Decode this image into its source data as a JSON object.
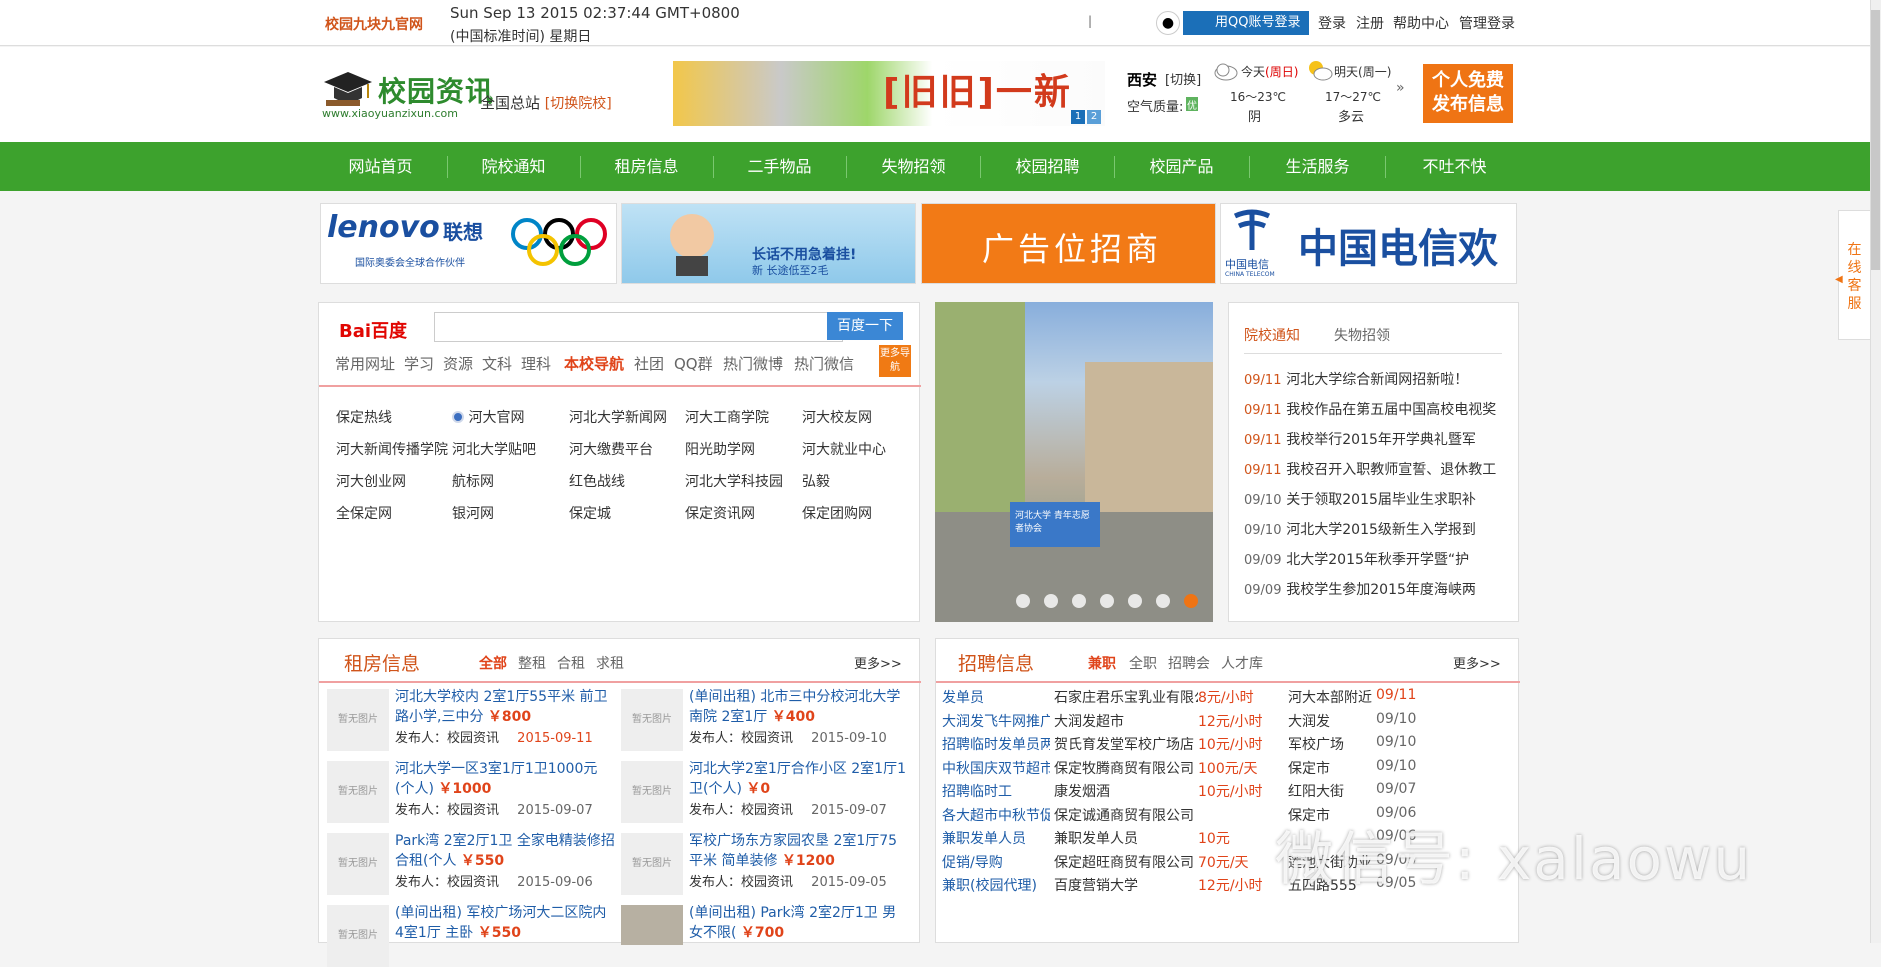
{
  "topbar": {
    "site_name": "校园九块九官网",
    "datetime_line1": "Sun Sep 13 2015 02:37:44 GMT+0800",
    "datetime_line2": "(中国标准时间) 星期日",
    "qq_login": "用QQ账号登录",
    "links": [
      "登录",
      "注册",
      "帮助中心",
      "管理登录"
    ]
  },
  "header": {
    "logo_text": "校园资讯",
    "logo_url": "www.xiaoyuanzixun.com",
    "branch": "全国总站",
    "branch_switch": "[切换院校]",
    "ad_text": "[旧旧]一新",
    "ad_pages": [
      "1",
      "2"
    ],
    "city": "西安",
    "city_switch": "[切换]",
    "air_quality_label": "空气质量:",
    "air_quality_value": "优",
    "weather": [
      {
        "label": "今天",
        "day": "(周日)",
        "temp": "16～23℃",
        "desc": "阴"
      },
      {
        "label": "明天",
        "day": "(周一)",
        "temp": "17～27℃",
        "desc": "多云"
      }
    ],
    "publish_button": [
      "个人免费",
      "发布信息"
    ]
  },
  "nav": [
    "网站首页",
    "院校通知",
    "租房信息",
    "二手物品",
    "失物招领",
    "校园招聘",
    "校园产品",
    "生活服务",
    "不吐不快"
  ],
  "ads": [
    {
      "brand": "lenovo",
      "brand_cn": "联想",
      "sub": "国际奥委会全球合作伙伴"
    },
    {
      "text": "长话不用急着挂!",
      "sub": "新 长途低至2毛"
    },
    {
      "text": "广告位招商"
    },
    {
      "brand": "中国电信",
      "brand_en": "CHINA TELECOM",
      "text": "中国电信欢迎您"
    }
  ],
  "search": {
    "logo": "Bai百度",
    "placeholder": "",
    "button": "百度一下",
    "tabs": [
      "常用网址",
      "学习",
      "资源",
      "文科",
      "理科",
      "本校导航",
      "社团",
      "QQ群",
      "热门微博",
      "热门微信"
    ],
    "active_tab": "本校导航",
    "more": "更多导航",
    "links": [
      [
        "保定热线",
        "河大官网",
        "河北大学新闻网",
        "河大工商学院",
        "河大校友网"
      ],
      [
        "河大新闻传播学院",
        "河北大学贴吧",
        "河大缴费平台",
        "阳光助学网",
        "河大就业中心"
      ],
      [
        "河大创业网",
        "航标网",
        "红色战线",
        "河北大学科技园",
        "弘毅"
      ],
      [
        "全保定网",
        "银河网",
        "保定城",
        "保定资讯网",
        "保定团购网"
      ]
    ]
  },
  "slider": {
    "dots": 7,
    "active": 7,
    "banner_text": "河北大学 青年志愿者协会"
  },
  "notices": {
    "tabs": [
      "院校通知",
      "失物招领"
    ],
    "items": [
      {
        "date": "09/11",
        "title": "河北大学综合新闻网招新啦！"
      },
      {
        "date": "09/11",
        "title": "我校作品在第五届中国高校电视奖"
      },
      {
        "date": "09/11",
        "title": "我校举行2015年开学典礼暨军"
      },
      {
        "date": "09/11",
        "title": "我校召开入职教师宣誓、退休教工"
      },
      {
        "date": "09/10",
        "title": "关于领取2015届毕业生求职补"
      },
      {
        "date": "09/10",
        "title": "河北大学2015级新生入学报到"
      },
      {
        "date": "09/09",
        "title": "北大学2015年秋季开学暨“护"
      },
      {
        "date": "09/09",
        "title": "我校学生参加2015年度海峡两"
      }
    ]
  },
  "rent": {
    "title": "租房信息",
    "filters": [
      "全部",
      "整租",
      "合租",
      "求租"
    ],
    "more": "更多>>",
    "no_photo": "暂无图片",
    "publisher_label": "发布人：",
    "items": [
      {
        "title": "河北大学校内 2室1厅55平米 前卫路小学,三中分",
        "price": "￥800",
        "publisher": "校园资讯",
        "date": "2015-09-11"
      },
      {
        "title": "(单间出租) 北市三中分校河北大学南院 2室1厅",
        "price": "￥400",
        "publisher": "校园资讯",
        "date": "2015-09-10"
      },
      {
        "title": "河北大学一区3室1厅1卫1000元(个人)",
        "price": "￥1000",
        "publisher": "校园资讯",
        "date": "2015-09-07"
      },
      {
        "title": "河北大学2室1厅合作小区 2室1厅1卫(个人)",
        "price": "￥0",
        "publisher": "校园资讯",
        "date": "2015-09-07"
      },
      {
        "title": "Park湾 2室2厅1卫 全家电精装修招合租(个人",
        "price": "￥550",
        "publisher": "校园资讯",
        "date": "2015-09-06"
      },
      {
        "title": "军校广场东方家园农垦 2室1厅75平米 简单装修",
        "price": "￥1200",
        "publisher": "校园资讯",
        "date": "2015-09-05"
      },
      {
        "title": "(单间出租) 军校广场河大二区院内 4室1厅 主卧",
        "price": "￥550",
        "publisher": "",
        "date": ""
      },
      {
        "title": "(单间出租) Park湾 2室2厅1卫 男女不限(",
        "price": "￥700",
        "publisher": "",
        "date": ""
      }
    ]
  },
  "jobs": {
    "title": "招聘信息",
    "filters": [
      "兼职",
      "全职",
      "招聘会",
      "人才库"
    ],
    "more": "更多>>",
    "items": [
      {
        "role": "发单员",
        "company": "石家庄君乐宝乳业有限公司",
        "pay": "8元/小时",
        "place": "河大本部附近",
        "date": "09/11"
      },
      {
        "role": "大润发飞牛网推广人",
        "company": "大润发超市",
        "pay": "12元/小时",
        "place": "大润发",
        "date": "09/10"
      },
      {
        "role": "招聘临时发单员两名",
        "company": "贺氏育发堂军校广场店",
        "pay": "10元/小时",
        "place": "军校广场",
        "date": "09/10"
      },
      {
        "role": "中秋国庆双节超市临",
        "company": "保定牧腾商贸有限公司",
        "pay": "100元/天",
        "place": "保定市",
        "date": "09/10"
      },
      {
        "role": "招聘临时工",
        "company": "康发烟酒",
        "pay": "10元/小时",
        "place": "红阳大街",
        "date": "09/07"
      },
      {
        "role": "各大超市中秋节促销",
        "company": "保定诚通商贸有限公司",
        "pay": "",
        "place": "保定市",
        "date": "09/06"
      },
      {
        "role": "兼职发单人员",
        "company": "兼职发单人员",
        "pay": "10元",
        "place": "",
        "date": "09/06"
      },
      {
        "role": "促销/导购",
        "company": "保定超旺商贸有限公司（公",
        "pay": "70元/天",
        "place": "莲池大街劝业",
        "date": "09/05"
      },
      {
        "role": "兼职(校园代理)",
        "company": "百度营销大学",
        "pay": "12元/小时",
        "place": "五四路555",
        "date": "09/05"
      }
    ]
  },
  "watermark": "微信号: xalaowu",
  "side_service": [
    "在",
    "线",
    "客",
    "服"
  ],
  "colors": {
    "green": "#3da22d",
    "orange": "#ef7414",
    "title_orange": "#d0541a",
    "link_blue": "#1f5da8",
    "price_red": "#e0441a"
  }
}
